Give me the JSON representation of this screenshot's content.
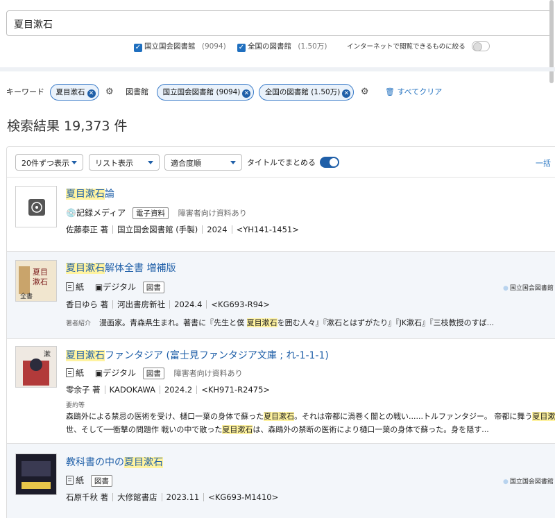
{
  "search": {
    "query": "夏目漱石"
  },
  "filters": {
    "ndl": {
      "label": "国立国会図書館",
      "count": "(9094)"
    },
    "all_libs": {
      "label": "全国の図書館",
      "count": "(1.50万)"
    },
    "online_label": "インターネットで閲覧できるものに絞る"
  },
  "chips": {
    "keyword_label": "キーワード",
    "keyword_value": "夏目漱石",
    "library_label": "図書館",
    "lib1": "国立国会図書館 (9094)",
    "lib2": "全国の図書館 (1.50万)",
    "clear_all": "すべてクリア"
  },
  "result_count": "検索結果 19,373 件",
  "toolbar": {
    "per_page": "20件ずつ表示",
    "view": "リスト表示",
    "sort": "適合度順",
    "group_by_title": "タイトルでまとめる",
    "bulk": "一括"
  },
  "results": [
    {
      "title_hl": "夏目漱石",
      "title_rest": "論",
      "format1": "記録メディア",
      "tag1": "電子資料",
      "note": "障害者向け資料あり",
      "author": "佐藤泰正 著",
      "publisher": "国立国会図書館 (手製)",
      "year": "2024",
      "callno": "<YH141-1451>"
    },
    {
      "title_hl": "夏目漱石",
      "title_rest": "解体全書 増補版",
      "format1": "紙",
      "format2": "デジタル",
      "tag1": "図書",
      "author": "香日ゆら 著",
      "publisher": "河出書房新社",
      "year": "2024.4",
      "callno": "<KG693-R94>",
      "intro_label": "著者紹介",
      "intro_a": "漫画家。青森県生まれ。著書に『先生と僕 ",
      "intro_hl": "夏目漱石",
      "intro_b": "を囲む人々』『漱石とはずがたり』『JK漱石』『三枝教授のすば...",
      "library": "国立国会図書館"
    },
    {
      "title_hl": "夏目漱石",
      "title_rest": "ファンタジア (富士見ファンタジア文庫 ; れ-1-1-1)",
      "format1": "紙",
      "format2": "デジタル",
      "tag1": "図書",
      "note": "障害者向け資料あり",
      "author": "零余子 著",
      "publisher": "KADOKAWA",
      "year": "2024.2",
      "callno": "<KH971-R2475>",
      "summary_label": "要約等",
      "s1a": "森鴎外による禁忌の医術を受け、樋口一葉の身体で蘇った",
      "s1hl": "夏目漱石",
      "s1b": "。それは帝都に渦巻く闇との戦い......トルファンタジー。 帝都に舞う",
      "s1hl2": "夏目漱石",
      "s1c": "、明",
      "s2a": "世、そして──衝撃の問題作 戦いの中で散った",
      "s2hl": "夏目漱石",
      "s2b": "は、森鴎外の禁断の医術により樋口一葉の身体で蘇った。身を隠す..."
    },
    {
      "title_a": "教科書の中の",
      "title_hl": "夏目漱石",
      "format1": "紙",
      "tag1": "図書",
      "author": "石原千秋 著",
      "publisher": "大修館書店",
      "year": "2023.11",
      "callno": "<KG693-M1410>",
      "library": "国立国会図書館"
    }
  ],
  "colors": {
    "accent": "#1f5fa8",
    "highlight": "#fff3a0",
    "row_alt": "#f3f6fa"
  }
}
